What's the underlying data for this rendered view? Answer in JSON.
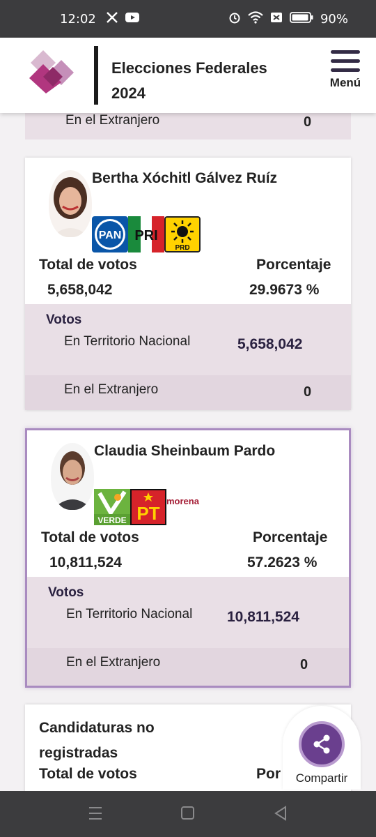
{
  "status_bar": {
    "time": "12:02",
    "battery": "90%",
    "icons": [
      "x-icon",
      "youtube-icon",
      "alarm-icon",
      "wifi-icon",
      "notification-icon",
      "battery-icon"
    ]
  },
  "header": {
    "title": "Elecciones Federales 2024",
    "menu_label": "Menú"
  },
  "previous_row": {
    "label": "En el Extranjero",
    "value": "0"
  },
  "candidates": [
    {
      "name": "Bertha Xóchitl Gálvez Ruíz",
      "parties": [
        "PAN",
        "PRI",
        "PRD"
      ],
      "total_label": "Total de votos",
      "total_value": "5,658,042",
      "pct_label": "Porcentaje",
      "pct_value": "29.9673 %",
      "votos_label": "Votos",
      "territorio_label": "En Territorio Nacional",
      "territorio_value": "5,658,042",
      "extranjero_label": "En el Extranjero",
      "extranjero_value": "0",
      "winner": false
    },
    {
      "name": "Claudia Sheinbaum Pardo",
      "parties": [
        "VERDE",
        "PT",
        "morena"
      ],
      "total_label": "Total de votos",
      "total_value": "10,811,524",
      "pct_label": "Porcentaje",
      "pct_value": "57.2623 %",
      "votos_label": "Votos",
      "territorio_label": "En Territorio Nacional",
      "territorio_value": "10,811,524",
      "extranjero_label": "En el Extranjero",
      "extranjero_value": "0",
      "winner": true
    }
  ],
  "no_registradas": {
    "title": "Candidaturas no registradas",
    "total_label": "Total de votos",
    "pct_label_partial": "Por"
  },
  "share": {
    "label": "Compartir"
  },
  "colors": {
    "accent": "#6a3f8e",
    "detail_bg": "#e9dfe6",
    "winner_border": "#a98bc0"
  }
}
